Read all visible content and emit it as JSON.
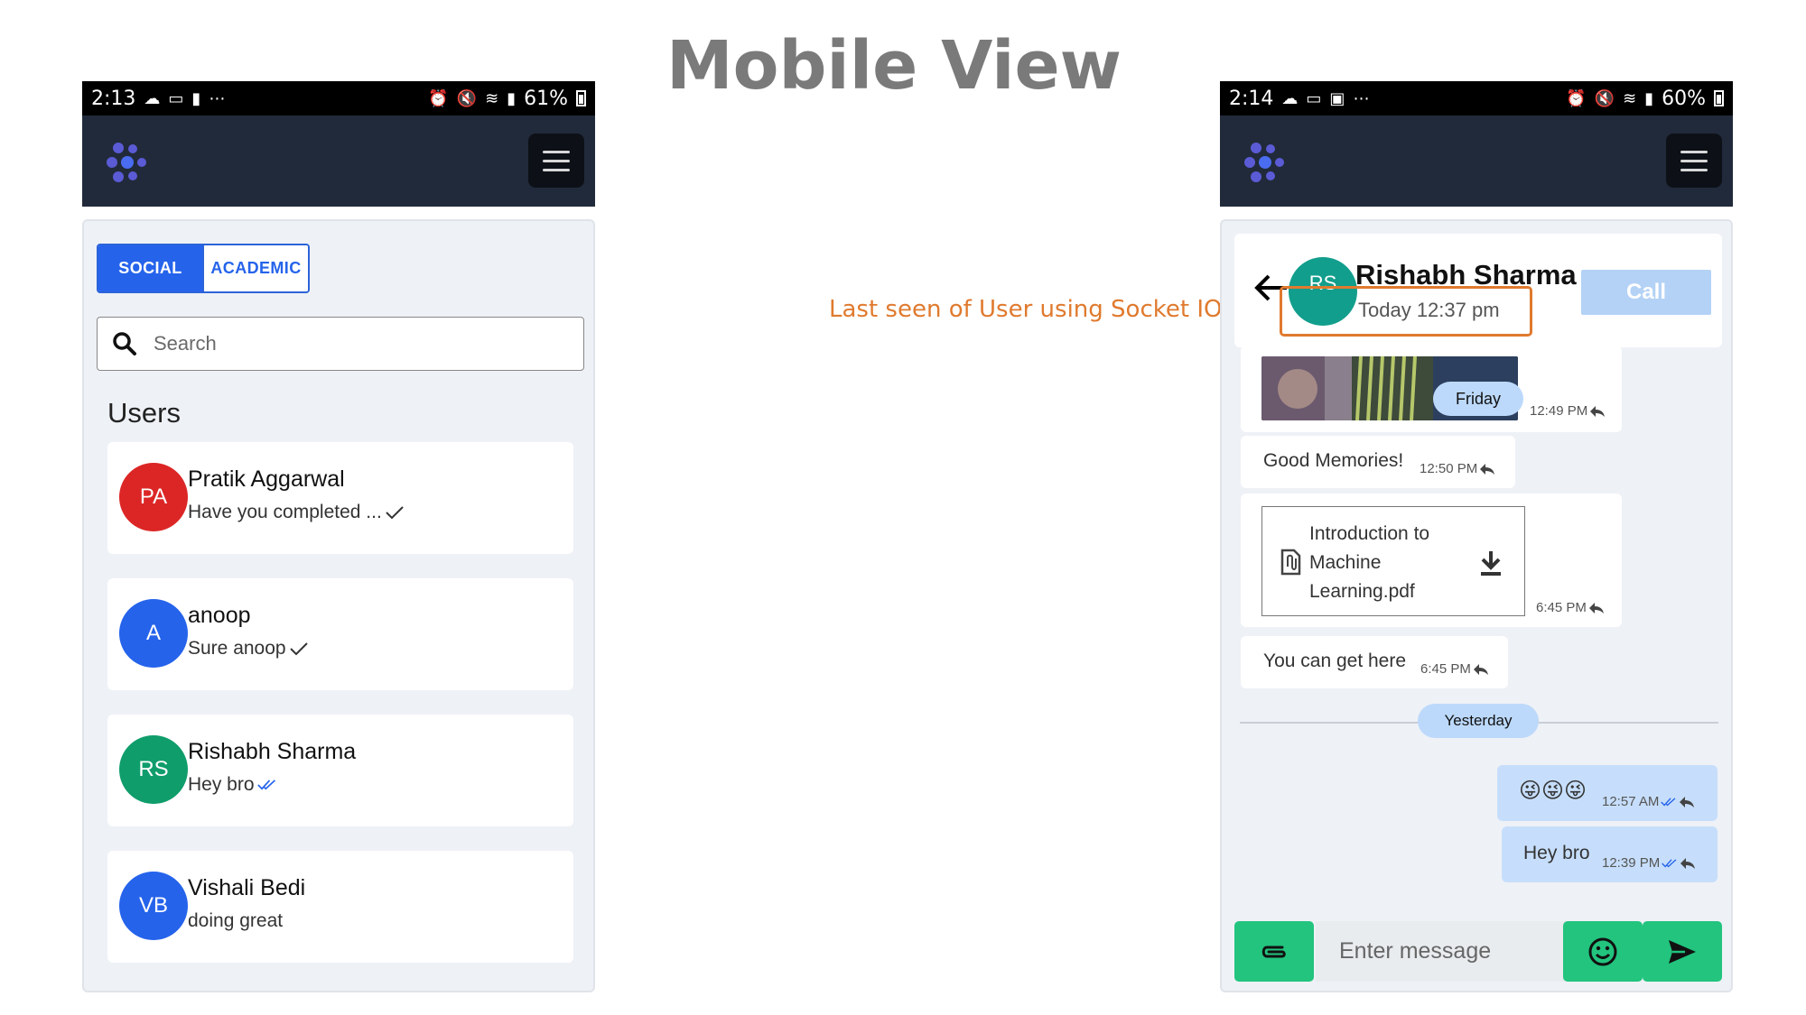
{
  "slide": {
    "title": "Mobile View",
    "annotation": "Last seen of User using Socket IO"
  },
  "left_phone": {
    "status": {
      "time": "2:13",
      "battery": "61%"
    },
    "tabs": [
      {
        "label": "SOCIAL",
        "active": true
      },
      {
        "label": "ACADEMIC",
        "active": false
      }
    ],
    "search": {
      "placeholder": "Search"
    },
    "users_heading": "Users",
    "users": [
      {
        "initials": "PA",
        "name": "Pratik Aggarwal",
        "last_message": "Have you completed ...",
        "tick": "single",
        "avatar_color": "#dc2626"
      },
      {
        "initials": "A",
        "name": "anoop",
        "last_message": "Sure anoop",
        "tick": "single",
        "avatar_color": "#2563eb"
      },
      {
        "initials": "RS",
        "name": "Rishabh Sharma",
        "last_message": "Hey bro",
        "tick": "double-blue",
        "avatar_color": "#0f9d6b"
      },
      {
        "initials": "VB",
        "name": "Vishali Bedi",
        "last_message": "doing great",
        "tick": "none",
        "avatar_color": "#2563eb"
      }
    ]
  },
  "right_phone": {
    "status": {
      "time": "2:14",
      "battery": "60%"
    },
    "chat_header": {
      "initials": "RS",
      "name": "Rishabh Sharma",
      "last_seen": "Today 12:37 pm",
      "call_label": "Call"
    },
    "messages": [
      {
        "type": "image",
        "day_pill": "Friday",
        "time": "12:49 PM"
      },
      {
        "type": "text",
        "text": "Good Memories!",
        "time": "12:50 PM"
      },
      {
        "type": "file",
        "file_name": "Introduction to Machine Learning.pdf",
        "time": "6:45 PM"
      },
      {
        "type": "text",
        "text": "You can get here",
        "time": "6:45 PM"
      },
      {
        "type": "divider",
        "label": "Yesterday"
      },
      {
        "type": "emoji",
        "text": "😜😜😜",
        "time": "12:57 AM"
      },
      {
        "type": "text",
        "text": "Hey bro",
        "time": "12:39 PM"
      }
    ],
    "composer": {
      "placeholder": "Enter message"
    }
  },
  "colors": {
    "navbar": "#212a3a",
    "accent_blue": "#2563eb",
    "send_green": "#22c47e",
    "highlight_orange": "#e07a2e",
    "outgoing_bubble": "#c6defb"
  }
}
